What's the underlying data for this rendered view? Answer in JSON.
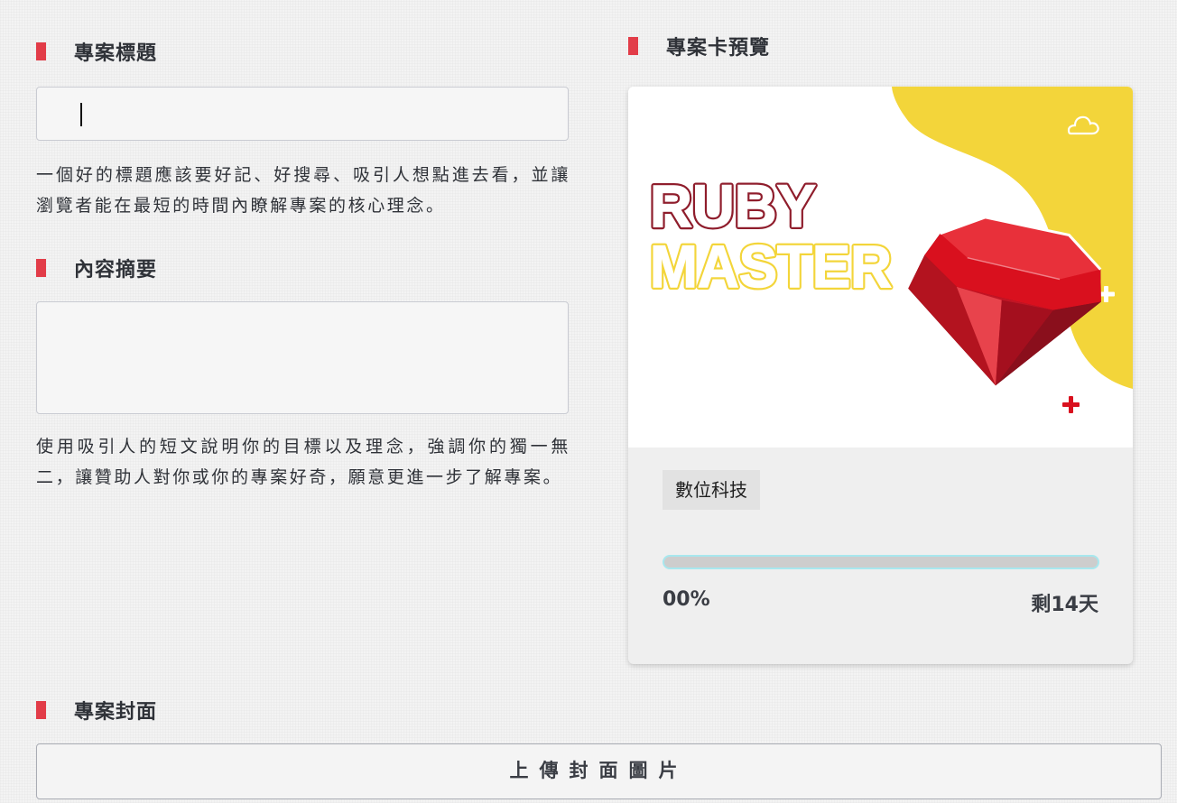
{
  "form": {
    "title_section": {
      "heading": "專案標題",
      "input_value": "",
      "help": "一個好的標題應該要好記、好搜尋、吸引人想點進去看，並讓瀏覽者能在最短的時間內瞭解專案的核心理念。"
    },
    "summary_section": {
      "heading": "內容摘要",
      "input_value": "",
      "help": "使用吸引人的短文說明你的目標以及理念，強調你的獨一無二，讓贊助人對你或你的專案好奇，願意更進一步了解專案。"
    },
    "cover_section": {
      "heading": "專案封面",
      "upload_label": "上傳封面圖片"
    }
  },
  "preview": {
    "heading": "專案卡預覽",
    "image": {
      "line1": "RUBY",
      "line2": "MASTER",
      "icons": [
        "cloud-icon",
        "plus-icon",
        "plus-icon",
        "ruby-gem-icon"
      ]
    },
    "category": "數位科技",
    "progress_percent": 0,
    "percent_label": "00%",
    "days_left": "剩14天"
  },
  "colors": {
    "accent": "#e23c48",
    "ruby_red": "#8f1d2c",
    "ruby_gem": "#d9101e",
    "yellow": "#f3d53a",
    "progress_border": "#a8e7ee"
  }
}
